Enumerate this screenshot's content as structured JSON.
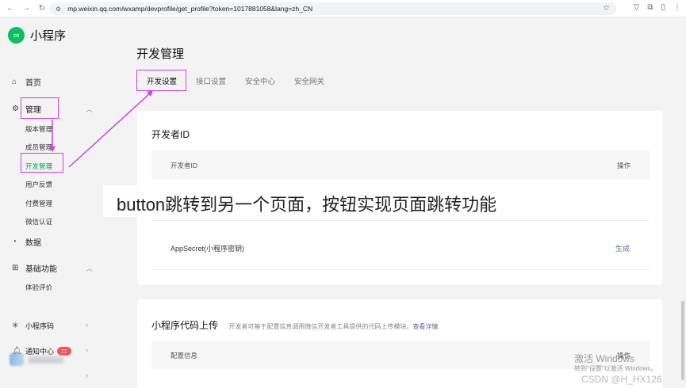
{
  "browser": {
    "url": "mp.weixin.qq.com/wxamp/devprofile/get_profile?token=1017881058&lang=zh_CN"
  },
  "sidebar": {
    "logo_text": "小程序",
    "home": "首页",
    "manage": "管理",
    "sub_items": [
      "版本管理",
      "成员管理",
      "开发管理",
      "用户反馈",
      "付费管理",
      "微信认证"
    ],
    "data": "数据",
    "basic": "基础功能",
    "basic_sub": "体验评价",
    "miniprogram_code": "小程序码",
    "notice": "通知中心",
    "notice_count": "11"
  },
  "main": {
    "title": "开发管理",
    "tabs": [
      "开发设置",
      "接口设置",
      "安全中心",
      "安全网关"
    ],
    "dev_id_card": {
      "title": "开发者ID",
      "col_left": "开发者ID",
      "col_right": "操作",
      "appsecret_label": "AppSecret(小程序密钥)",
      "appsecret_action": "生成"
    },
    "upload_card": {
      "title": "小程序代码上传",
      "subtitle": "开发者可基于配置信息调用微信开发者工具提供的代码上传模块。",
      "detail_link": "查看详情",
      "col_left": "配置信息",
      "col_right": "操作"
    }
  },
  "overlay": {
    "caption": "button跳转到另一个页面，按钮实现页面跳转功能"
  },
  "watermark": {
    "line1": "激活 Windows",
    "line2": "转到\"设置\"以激活 Windows。",
    "line3": "CSDN @H_HX126"
  }
}
